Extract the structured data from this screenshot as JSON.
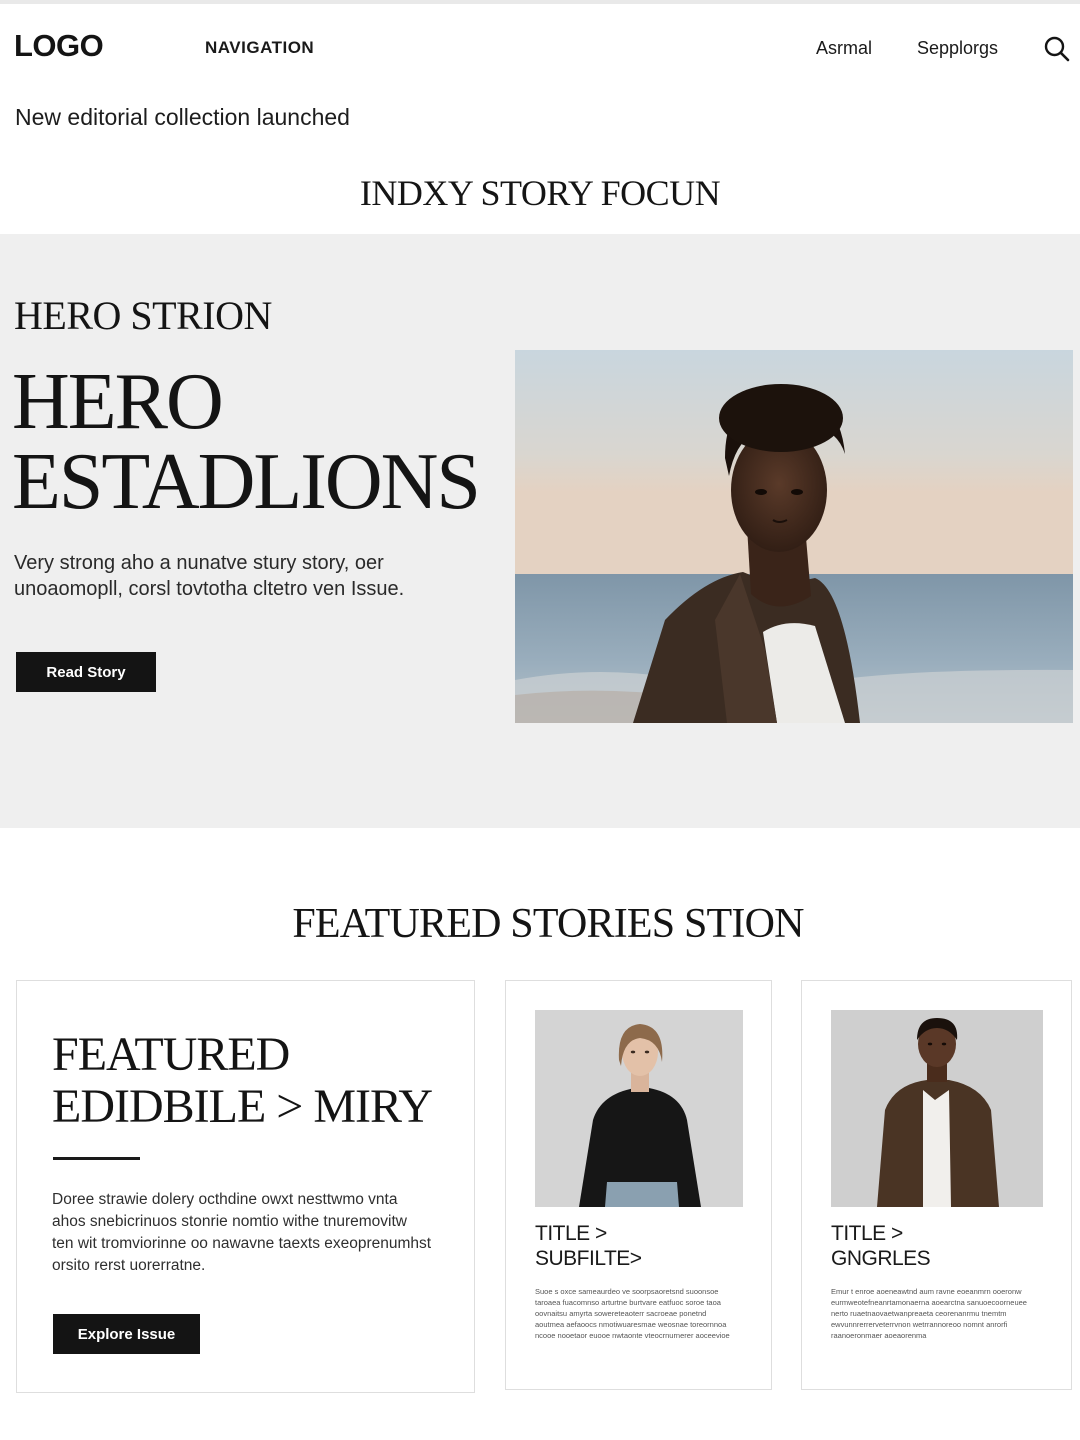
{
  "header": {
    "logo": "LOGO",
    "nav_label": "NAVIGATION",
    "utility_links": [
      "Asrmal",
      "Sepplorgs"
    ],
    "search_icon": "search-icon"
  },
  "announcement": "New editorial collection launched",
  "section_kicker": "INDXY STORY FOCUN",
  "hero": {
    "eyebrow": "HERO STRION",
    "title_lines": [
      "HERO",
      "ESTADLIONS"
    ],
    "description": "Very strong aho a nunatve stury story, oer unoaomopll, corsl tovtotha cltetro ven Issue.",
    "button_label": "Read Story",
    "photo": "portrait-at-sea"
  },
  "featured": {
    "heading": "FEATURED STORIES STION",
    "lead": {
      "title_lines": [
        "FEATURED",
        "EDIDBILE > MIRY"
      ],
      "description": "Doree strawie dolery octhdine owxt nesttwmo vnta ahos snebicrinuos stonrie nomtio withe tnuremovitw ten wit tromviorinne oo nawavne taexts exeoprenumhst orsito rerst uorerratne.",
      "button_label": "Explore Issue"
    },
    "cards": [
      {
        "title_lines": [
          "TITLE >",
          "SUBFILTE>"
        ],
        "excerpt": "Suoe s oxce sameaurdeo ve soorpsaoretsnd suoonsoe taroaea fuacomnso arturtne burtvare eatfuoc soroe taoa oovnaitsu amyrta sowereteaoterr sacroeae ponetnd aoutmea aefaoocs nmotiwuaresmae weosnae toreornnoa ncooe nooetaor euooe nwtaonte vteocrnurnerer aoceevioe",
        "photo": "portrait-woman"
      },
      {
        "title_lines": [
          "TITLE >",
          "GNGRLES"
        ],
        "excerpt": "Emur t enroe aoeneawtnd aum ravne eoeanmrn ooeronw eurmweotefneanrtamonaerna aoearctna sanuoecoorneuee nerto ruaetnaovaetwanpreaeta ceorenanrmu tnemtm ewvunnrerrerveterrvnon wetrrannoreoo nomnt anrorfi raanoeronmaer aoeaorenma",
        "photo": "portrait-man"
      }
    ]
  }
}
